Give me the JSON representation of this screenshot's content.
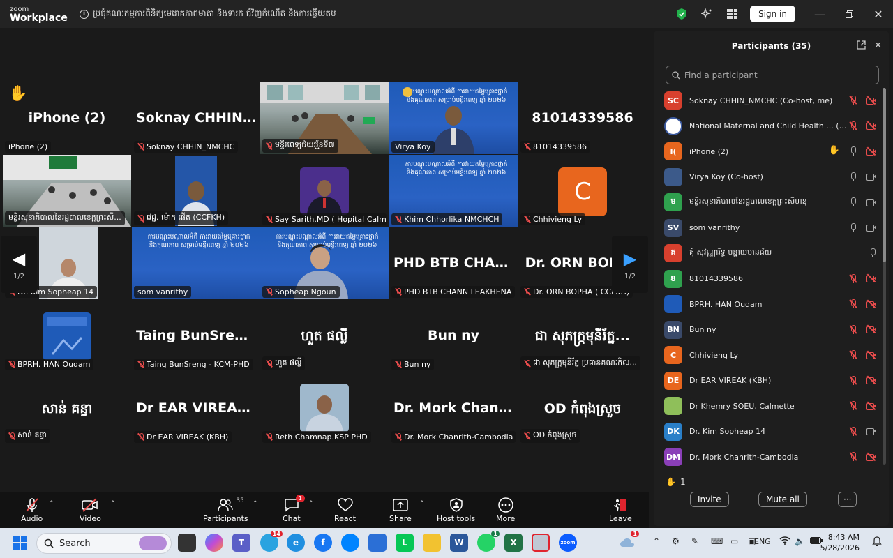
{
  "titlebar": {
    "logo_line1": "zoom",
    "logo_line2": "Workplace",
    "meeting_title": "ប្រជុំគណៈកម្មការពិនិត្យមេរោគភាពមាតា និងទារក ជុំវិញកំណើត និងការឆ្លើយតប",
    "sign_in": "Sign in"
  },
  "tiles": [
    {
      "big": "iPhone (2)",
      "label": "iPhone (2)",
      "hand": "✋"
    },
    {
      "big": "Soknay  CHHIN_...",
      "label": "Soknay CHHIN_NMCHC"
    },
    {
      "label": "មន្ទីរពេទ្យជ័យវរ្ម័នទី៧"
    },
    {
      "label": "Virya Koy",
      "slide": "ការបណ្តុះបណ្តាលអំពី ការវាយតម្លៃគ្រោះថ្នាក់ និងគុណភាព សម្រាប់មន្ទីរពេទ្យ ឆ្នាំ ២០២៦"
    },
    {
      "big": "81014339586",
      "label": "81014339586"
    },
    {
      "label": "មន្ទីរសុខាភិបាលនៃរដ្ឋបាលខេត្តព្រះសី..."
    },
    {
      "label": "វេជ្ជ. ម៉ោក ផើត (CCFKH)"
    },
    {
      "label": "Say Sarith.MD ( Hopital Calmette)"
    },
    {
      "label": "Khim Chhorlika NMCHCH",
      "slide": "ការបណ្តុះបណ្តាលអំពី ការវាយតម្លៃគ្រោះថ្នាក់ និងគុណភាព សម្រាប់មន្ទីរពេទ្យ ឆ្នាំ ២០២៦"
    },
    {
      "label": "Chhivieng Ly",
      "initial": "C"
    },
    {
      "label": "Dr. Kim Sopheap 14"
    },
    {
      "label": "som vanrithy",
      "slide": "ការបណ្តុះបណ្តាលអំពី ការវាយតម្លៃគ្រោះថ្នាក់ និងគុណភាព សម្រាប់មន្ទីរពេទ្យ ឆ្នាំ ២០២៦"
    },
    {
      "label": "Sopheap Ngoun",
      "slide": "ការបណ្តុះបណ្តាលអំពី ការវាយតម្លៃគ្រោះថ្នាក់ និងគុណភាព សម្រាប់មន្ទីរពេទ្យ ឆ្នាំ ២០២៦"
    },
    {
      "big": "PHD BTB CHAN...",
      "label": "PHD BTB CHANN LEAKHENA"
    },
    {
      "big": "Dr. ORN BOPHA",
      "label": "Dr. ORN BOPHA ( CCFKH)"
    },
    {
      "label": "BPRH. HAN Oudam"
    },
    {
      "big": "Taing  BunSreng...",
      "label": "Taing BunSreng - KCM-PHD"
    },
    {
      "big": "ហួត ផល្លី",
      "label": "ហួត ផល្លី"
    },
    {
      "big": "Bun ny",
      "label": "Bun ny"
    },
    {
      "big": "ជា សុភក្រ្កមុនីរ័ត្ន...",
      "label": "ជា សុភក្រ្កមុនីរ័ត្ន ប្រធានគណៈកិល..."
    },
    {
      "big": "សាន់ គន្ធា",
      "label": "សាន់ គន្ធា"
    },
    {
      "big": "Dr EAR VIREAK...",
      "label": "Dr EAR VIREAK (KBH)"
    },
    {
      "label": "Reth Chamnap.KSP PHD"
    },
    {
      "big": "Dr. Mork Chanri...",
      "label": "Dr. Mork Chanrith-Cambodia"
    },
    {
      "big": "OD កំពុងស្រួច",
      "label": "OD កំពុងស្រួច"
    }
  ],
  "nav": {
    "page": "1/2",
    "prev": "◀",
    "next": "▶"
  },
  "toolbar": {
    "audio": "Audio",
    "video": "Video",
    "participants": "Participants",
    "participants_count": "35",
    "chat": "Chat",
    "chat_badge": "1",
    "react": "React",
    "share": "Share",
    "host_tools": "Host tools",
    "more": "More",
    "leave": "Leave"
  },
  "panel": {
    "title": "Participants (35)",
    "search_placeholder": "Find a participant",
    "raised_count": "1",
    "invite": "Invite",
    "mute_all": "Mute all",
    "more": "···",
    "participants": [
      {
        "initials": "SC",
        "name": "Soknay CHHIN_NMCHC (Co-host, me)",
        "color": "#d8402e",
        "mic": "off",
        "cam": "off"
      },
      {
        "initials": "",
        "name": "National Maternal and Child Health ... (Host)",
        "color": "#ffffff",
        "mic": "off",
        "cam": "off"
      },
      {
        "initials": "I(",
        "name": "iPhone (2)",
        "color": "#e8661e",
        "mic": "on",
        "cam": "off",
        "hand": "✋"
      },
      {
        "initials": "",
        "name": "Virya Koy (Co-host)",
        "color": "#3c5a8a",
        "mic": "on",
        "cam": "on"
      },
      {
        "initials": "ម",
        "name": "មន្ទីរសុខាភិបាលនៃរដ្ឋបាលខេត្តព្រះសីហនុ",
        "color": "#2fa14e",
        "mic": "on",
        "cam": "on"
      },
      {
        "initials": "SV",
        "name": "som vanrithy",
        "color": "#3a4a6a",
        "mic": "on",
        "cam": "on"
      },
      {
        "initials": "គ",
        "name": "គុំ សុវណ្ណារិទ្ធ បន្ទាយមានជ័យ",
        "color": "#d8402e",
        "mic": "on",
        "cam": ""
      },
      {
        "initials": "8",
        "name": "81014339586",
        "color": "#2fa14e",
        "mic": "off",
        "cam": "off"
      },
      {
        "initials": "",
        "name": "BPRH. HAN Oudam",
        "color": "#1f5bb8",
        "mic": "off",
        "cam": "off"
      },
      {
        "initials": "BN",
        "name": "Bun ny",
        "color": "#3a4a6a",
        "mic": "off",
        "cam": "off"
      },
      {
        "initials": "C",
        "name": "Chhivieng Ly",
        "color": "#e8661e",
        "mic": "off",
        "cam": "off"
      },
      {
        "initials": "DE",
        "name": "Dr EAR VIREAK (KBH)",
        "color": "#e8661e",
        "mic": "off",
        "cam": "off"
      },
      {
        "initials": "",
        "name": "Dr Khemry SOEU, Calmette",
        "color": "#8fbf5a",
        "mic": "off",
        "cam": "off"
      },
      {
        "initials": "DK",
        "name": "Dr. Kim Sopheap 14",
        "color": "#2a7fc8",
        "mic": "off",
        "cam": "on"
      },
      {
        "initials": "DM",
        "name": "Dr. Mork Chanrith-Cambodia",
        "color": "#8a3fb8",
        "mic": "off",
        "cam": "off"
      }
    ]
  },
  "taskbar": {
    "search": "Search",
    "lang": "ENG",
    "time": "8:43 AM",
    "date": "5/28/2026",
    "telegram_badge": "14",
    "whatsapp_badge": "1",
    "weather_badge": "1"
  }
}
